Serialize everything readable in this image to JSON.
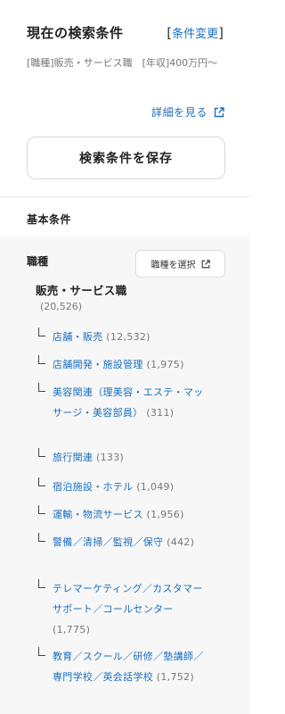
{
  "header": {
    "title": "現在の検索条件",
    "change_bracket_open": "[",
    "change_label": "条件変更",
    "change_bracket_close": "]"
  },
  "criteria_text": "[職種]販売・サービス職　[年収]400万円〜",
  "detail_link": "詳細を見る",
  "save_button": "検索条件を保存",
  "basic_section": "基本条件",
  "job_type": {
    "label": "職種",
    "select_button": "職種を選択",
    "category": "販売・サービス職",
    "category_count": "(20,526)",
    "items": [
      {
        "name": "店舗・販売",
        "count": "(12,532)"
      },
      {
        "name": "店舗開発・施設管理",
        "count": "(1,975)"
      },
      {
        "name": "美容関連（理美容・エステ・マッサージ・美容部員）",
        "count": "(311)"
      },
      {
        "name": "旅行関連",
        "count": "(133)"
      },
      {
        "name": "宿泊施設・ホテル",
        "count": "(1,049)"
      },
      {
        "name": "運輸・物流サービス",
        "count": "(1,956)"
      },
      {
        "name": "警備／清掃／監視／保守",
        "count": "(442)"
      },
      {
        "name": "テレマーケティング／カスタマーサポート／コールセンター",
        "count": "(1,775)"
      },
      {
        "name": "教育／スクール／研修／塾講師／専門学校／英会話学校",
        "count": "(1,752)"
      }
    ]
  },
  "colors": {
    "link": "#1a6fbf",
    "muted": "#777777",
    "panel_bg": "#f7f7f7"
  },
  "icons": {
    "detail": "external-link-icon",
    "select": "external-link-icon"
  }
}
